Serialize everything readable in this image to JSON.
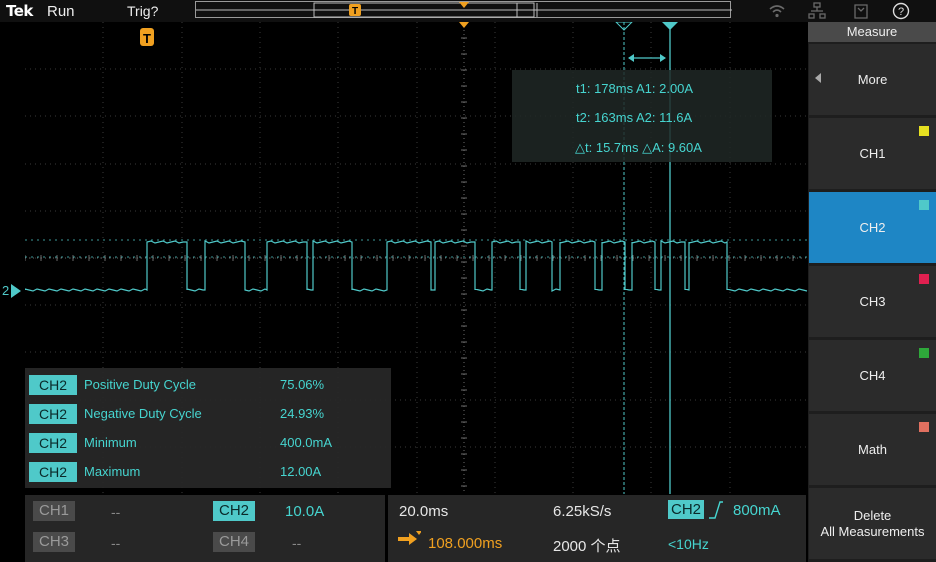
{
  "topbar": {
    "brand": "Tek",
    "run_state": "Run",
    "trigger_state": "Trig?",
    "trigger_marker_label": "T"
  },
  "waveform": {
    "trigger_marker_label": "T",
    "channel_marker_label": "2",
    "trace_color": "#4fc9c9"
  },
  "cursor_readout": {
    "line1": "t1: 178ms  A1: 2.00A",
    "line2": "t2: 163ms  A2: 11.6A",
    "line3": "△t: 15.7ms  △A: 9.60A"
  },
  "measurements": [
    {
      "channel": "CH2",
      "name": "Positive Duty Cycle",
      "value": "75.06%"
    },
    {
      "channel": "CH2",
      "name": "Negative Duty Cycle",
      "value": "24.93%"
    },
    {
      "channel": "CH2",
      "name": "Minimum",
      "value": "400.0mA"
    },
    {
      "channel": "CH2",
      "name": "Maximum",
      "value": "12.00A"
    }
  ],
  "side_menu": {
    "title": "Measure",
    "items": [
      {
        "label": "More",
        "swatch": ""
      },
      {
        "label": "CH1",
        "swatch": "#e6e021"
      },
      {
        "label": "CH2",
        "swatch": "#4fc9c9"
      },
      {
        "label": "CH3",
        "swatch": "#e02050"
      },
      {
        "label": "CH4",
        "swatch": "#2ea83a"
      },
      {
        "label": "Math",
        "swatch": "#e07060"
      },
      {
        "label": "Delete\nAll Measurements",
        "swatch": ""
      }
    ],
    "active_index": 2
  },
  "channels": {
    "ch1": {
      "label": "CH1",
      "scale": "--",
      "enabled": false
    },
    "ch2": {
      "label": "CH2",
      "scale": "10.0A",
      "enabled": true
    },
    "ch3": {
      "label": "CH3",
      "scale": "--",
      "enabled": false
    },
    "ch4": {
      "label": "CH4",
      "scale": "--",
      "enabled": false
    }
  },
  "acquisition": {
    "time_per_div": "20.0ms",
    "sample_rate": "6.25kS/s",
    "trigger_position": "108.000ms",
    "record_length": "2000 个点",
    "trigger_source": "CH2",
    "trigger_level": "800mA",
    "trigger_freq": "<10Hz"
  },
  "colors": {
    "ch2": "#4fc9c9",
    "accent_blue": "#1e86c5",
    "trigger_orange": "#f0a020"
  }
}
